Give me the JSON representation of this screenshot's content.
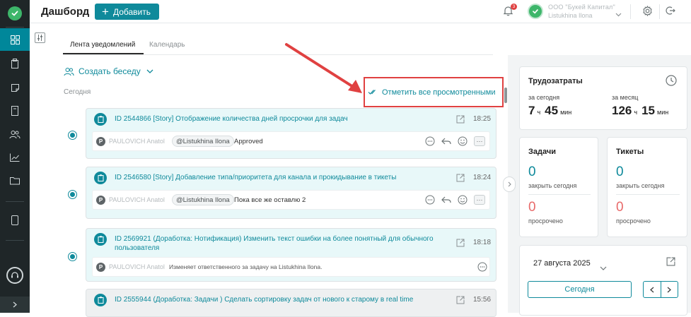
{
  "header": {
    "title": "Дашборд",
    "add_label": "Добавить",
    "notifications_count": "3",
    "user_company": "ООО \"Букей Капитал\"",
    "user_name": "Listukhina Ilona"
  },
  "tabs": [
    {
      "label": "Лента уведомлений",
      "active": true
    },
    {
      "label": "Календарь",
      "active": false
    }
  ],
  "feed": {
    "create_chat_label": "Создать беседу",
    "section_label": "Сегодня",
    "mark_all_label": "Отметить все просмотренными",
    "items": [
      {
        "title": "ID 2544866 [Story] Отображение количества дней просрочки для задач",
        "time": "18:25",
        "author": "PAULOVICH Anatol",
        "mention": "@Listukhina Ilona",
        "message": "Approved"
      },
      {
        "title": "ID 2546580 [Story] Добавление типа/приоритета для канала и прокидывание в тикеты",
        "time": "18:24",
        "author": "PAULOVICH Anatol",
        "mention": "@Listukhina Ilona",
        "message": "Пока все же оставлю 2"
      },
      {
        "title": "ID 2569921 (Доработка: Нотификация) Изменить текст ошибки на более понятный для обычного пользователя",
        "time": "18:18",
        "author": "PAULOVICH Anatol",
        "message": "Изменяет ответственного за задачу на Listukhina Ilona."
      },
      {
        "title": "ID 2555944 (Доработка: Задачи ) Сделать сортировку задач от нового к старому в real time",
        "time": "15:56"
      }
    ]
  },
  "labor": {
    "title": "Трудозатраты",
    "today_label": "за сегодня",
    "month_label": "за месяц",
    "today_hours": "7",
    "today_minutes": "45",
    "month_hours": "126",
    "month_minutes": "15",
    "hours_unit": "ч",
    "minutes_unit": "мин"
  },
  "tasks": {
    "title": "Задачи",
    "close_today": "0",
    "close_today_label": "закрыть сегодня",
    "overdue": "0",
    "overdue_label": "просрочено"
  },
  "tickets": {
    "title": "Тикеты",
    "close_today": "0",
    "close_today_label": "закрыть сегодня",
    "overdue": "0",
    "overdue_label": "просрочено"
  },
  "calendar": {
    "date": "27 августа 2025",
    "today_label": "Сегодня"
  },
  "colors": {
    "accent": "#0f8a9b",
    "sidebar": "#1f2628",
    "danger": "#e04141",
    "success": "#3db66a"
  }
}
